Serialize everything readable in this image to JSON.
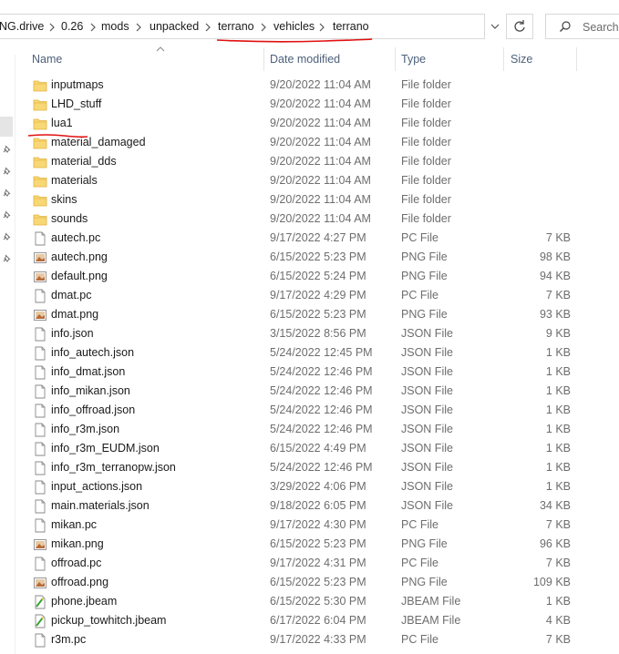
{
  "breadcrumb": [
    "NG.drive",
    "0.26",
    "mods",
    "unpacked",
    "terrano",
    "vehicles",
    "terrano"
  ],
  "search": {
    "placeholder": "Search te"
  },
  "columns": {
    "name": "Name",
    "date": "Date modified",
    "type": "Type",
    "size": "Size"
  },
  "colors": {
    "folder": "#f8d775",
    "header_text": "#4c607a",
    "annotation": "#e01010"
  },
  "files": [
    {
      "name": "inputmaps",
      "date": "9/20/2022 11:04 AM",
      "type": "File folder",
      "size": "",
      "icon": "folder-icon"
    },
    {
      "name": "LHD_stuff",
      "date": "9/20/2022 11:04 AM",
      "type": "File folder",
      "size": "",
      "icon": "folder-icon"
    },
    {
      "name": "lua1",
      "date": "9/20/2022 11:04 AM",
      "type": "File folder",
      "size": "",
      "icon": "folder-icon"
    },
    {
      "name": "material_damaged",
      "date": "9/20/2022 11:04 AM",
      "type": "File folder",
      "size": "",
      "icon": "folder-icon"
    },
    {
      "name": "material_dds",
      "date": "9/20/2022 11:04 AM",
      "type": "File folder",
      "size": "",
      "icon": "folder-icon"
    },
    {
      "name": "materials",
      "date": "9/20/2022 11:04 AM",
      "type": "File folder",
      "size": "",
      "icon": "folder-icon"
    },
    {
      "name": "skins",
      "date": "9/20/2022 11:04 AM",
      "type": "File folder",
      "size": "",
      "icon": "folder-icon"
    },
    {
      "name": "sounds",
      "date": "9/20/2022 11:04 AM",
      "type": "File folder",
      "size": "",
      "icon": "folder-icon"
    },
    {
      "name": "autech.pc",
      "date": "9/17/2022 4:27 PM",
      "type": "PC File",
      "size": "7 KB",
      "icon": "file-icon"
    },
    {
      "name": "autech.png",
      "date": "6/15/2022 5:23 PM",
      "type": "PNG File",
      "size": "98 KB",
      "icon": "image-file-icon"
    },
    {
      "name": "default.png",
      "date": "6/15/2022 5:24 PM",
      "type": "PNG File",
      "size": "94 KB",
      "icon": "image-file-icon"
    },
    {
      "name": "dmat.pc",
      "date": "9/17/2022 4:29 PM",
      "type": "PC File",
      "size": "7 KB",
      "icon": "file-icon"
    },
    {
      "name": "dmat.png",
      "date": "6/15/2022 5:23 PM",
      "type": "PNG File",
      "size": "93 KB",
      "icon": "image-file-icon"
    },
    {
      "name": "info.json",
      "date": "3/15/2022 8:56 PM",
      "type": "JSON File",
      "size": "9 KB",
      "icon": "file-icon"
    },
    {
      "name": "info_autech.json",
      "date": "5/24/2022 12:45 PM",
      "type": "JSON File",
      "size": "1 KB",
      "icon": "file-icon"
    },
    {
      "name": "info_dmat.json",
      "date": "5/24/2022 12:46 PM",
      "type": "JSON File",
      "size": "1 KB",
      "icon": "file-icon"
    },
    {
      "name": "info_mikan.json",
      "date": "5/24/2022 12:46 PM",
      "type": "JSON File",
      "size": "1 KB",
      "icon": "file-icon"
    },
    {
      "name": "info_offroad.json",
      "date": "5/24/2022 12:46 PM",
      "type": "JSON File",
      "size": "1 KB",
      "icon": "file-icon"
    },
    {
      "name": "info_r3m.json",
      "date": "5/24/2022 12:46 PM",
      "type": "JSON File",
      "size": "1 KB",
      "icon": "file-icon"
    },
    {
      "name": "info_r3m_EUDM.json",
      "date": "6/15/2022 4:49 PM",
      "type": "JSON File",
      "size": "1 KB",
      "icon": "file-icon"
    },
    {
      "name": "info_r3m_terranopw.json",
      "date": "5/24/2022 12:46 PM",
      "type": "JSON File",
      "size": "1 KB",
      "icon": "file-icon"
    },
    {
      "name": "input_actions.json",
      "date": "3/29/2022 4:06 PM",
      "type": "JSON File",
      "size": "1 KB",
      "icon": "file-icon"
    },
    {
      "name": "main.materials.json",
      "date": "9/18/2022 6:05 PM",
      "type": "JSON File",
      "size": "34 KB",
      "icon": "file-icon"
    },
    {
      "name": "mikan.pc",
      "date": "9/17/2022 4:30 PM",
      "type": "PC File",
      "size": "7 KB",
      "icon": "file-icon"
    },
    {
      "name": "mikan.png",
      "date": "6/15/2022 5:23 PM",
      "type": "PNG File",
      "size": "96 KB",
      "icon": "image-file-icon"
    },
    {
      "name": "offroad.pc",
      "date": "9/17/2022 4:31 PM",
      "type": "PC File",
      "size": "7 KB",
      "icon": "file-icon"
    },
    {
      "name": "offroad.png",
      "date": "6/15/2022 5:23 PM",
      "type": "PNG File",
      "size": "109 KB",
      "icon": "image-file-icon"
    },
    {
      "name": "phone.jbeam",
      "date": "6/15/2022 5:30 PM",
      "type": "JBEAM File",
      "size": "1 KB",
      "icon": "jbeam-file-icon"
    },
    {
      "name": "pickup_towhitch.jbeam",
      "date": "6/17/2022 6:04 PM",
      "type": "JBEAM File",
      "size": "4 KB",
      "icon": "jbeam-file-icon"
    },
    {
      "name": "r3m.pc",
      "date": "9/17/2022 4:33 PM",
      "type": "PC File",
      "size": "7 KB",
      "icon": "file-icon"
    }
  ]
}
